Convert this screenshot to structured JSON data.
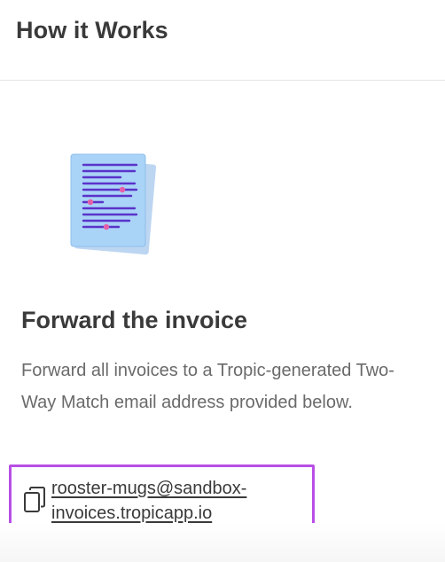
{
  "header": {
    "title": "How it Works"
  },
  "illustration": {
    "icon": "invoice-document-icon",
    "colors": {
      "paper_back": "#bcd6f2",
      "paper_front": "#a7d2f6",
      "lines": "#5a33c9",
      "dots": "#e55fa8"
    }
  },
  "step": {
    "title": "Forward the invoice",
    "description": "Forward all invoices to a Tropic-generated Two-Way Match email address provided below."
  },
  "email": {
    "line1": "rooster-mugs@sandbox-",
    "line2": "invoices.tropicapp.io",
    "copy_icon": "copy-icon",
    "highlight_color": "#b84ee6"
  }
}
